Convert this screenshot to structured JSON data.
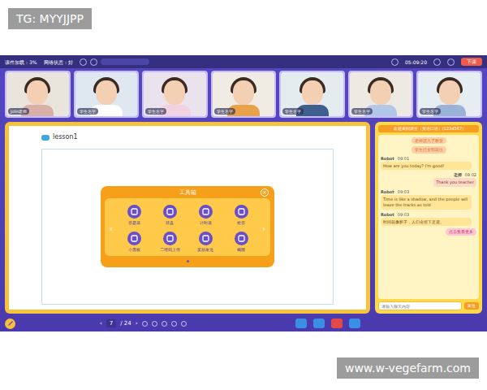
{
  "watermarks": {
    "top": "TG: MYYJJPP",
    "bottom": "www.w-vegefarm.com"
  },
  "top_bar": {
    "stats": [
      "课件加载：3%",
      "网络状态：好"
    ],
    "time": "05:09:20",
    "end_button": "下课"
  },
  "videos": [
    {
      "label": "Jolin老师"
    },
    {
      "label": "学生名字"
    },
    {
      "label": "学生名字"
    },
    {
      "label": "学生名字"
    },
    {
      "label": "学生名字"
    },
    {
      "label": "学生名字"
    },
    {
      "label": "学生名字"
    }
  ],
  "board": {
    "title": "lesson1",
    "toolbox": {
      "title": "工具箱",
      "close": "×",
      "prev": "‹",
      "next": "›",
      "tools": [
        "答题器",
        "转盘",
        "计时器",
        "抢答",
        "小黑板",
        "二维码上传",
        "奖励发送",
        "截图"
      ],
      "dots": [
        {
          "selected": true
        }
      ]
    }
  },
  "chat": {
    "title": "欢迎来到课堂（英语口语）(1234567)",
    "notices": [
      "老师进入了教室",
      "学生已全部就位"
    ],
    "messages": [
      {
        "sender": "Robot",
        "time": "09:01",
        "text": "How are you today? I'm good!",
        "kind": "received"
      },
      {
        "sender": "老师",
        "time": "09:02",
        "text": "Thank you teacher",
        "kind": "sent"
      },
      {
        "sender": "Robot",
        "time": "09:03",
        "text": "Time is like a shadow, and the people will leave the tracks as told",
        "kind": "received"
      },
      {
        "sender": "Robot",
        "time": "09:03",
        "text": "时间就像影子，人们会留下足迹。",
        "kind": "received"
      }
    ],
    "more": "点击查看更多",
    "input_placeholder": "请输入聊天内容",
    "send": "发送"
  },
  "bottom_bar": {
    "prev": "‹",
    "page": "7",
    "total": "/ 24",
    "next": "›"
  }
}
